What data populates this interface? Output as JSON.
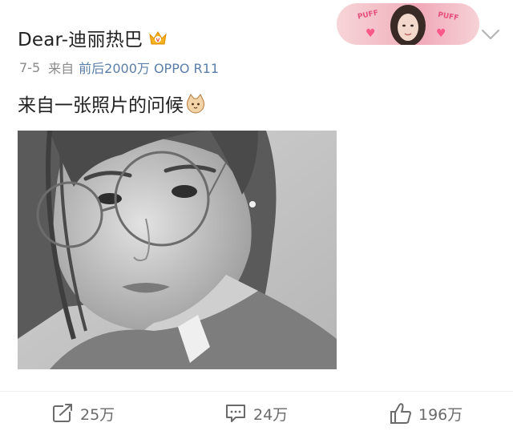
{
  "post": {
    "username": "Dear-迪丽热巴",
    "date": "7-5",
    "source_prefix": "来自",
    "source_device": "前后2000万 OPPO R11",
    "text": "来自一张照片的问候"
  },
  "banner": {
    "sticker_text_left": "PUFF",
    "sticker_text_right": "PUFF"
  },
  "actions": {
    "repost_count": "25万",
    "comment_count": "24万",
    "like_count": "196万"
  },
  "icons": {
    "vip": "crown-badge-icon",
    "menu": "chevron-down-icon",
    "emoji": "cat-emoji-icon",
    "repost": "repost-icon",
    "comment": "comment-icon",
    "like": "thumbs-up-icon"
  },
  "colors": {
    "text": "#222222",
    "meta": "#8a8a8a",
    "device_link": "#5b7ea8",
    "banner_pink": "#f2b6c0",
    "action_text": "#6a6a6a"
  }
}
